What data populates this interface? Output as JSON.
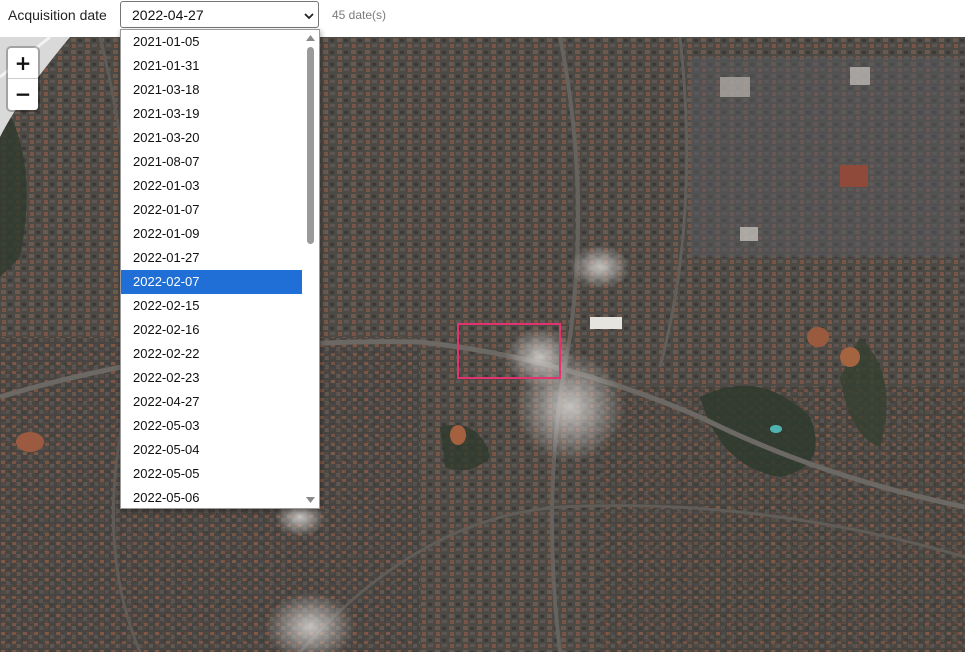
{
  "toolbar": {
    "label": "Acquisition date",
    "selected_value": "2022-04-27",
    "count_text": "45 date(s)"
  },
  "map": {
    "zoom_in_label": "+",
    "zoom_out_label": "−",
    "aoi_color": "#e0336f"
  },
  "dropdown": {
    "highlighted": "2022-02-07",
    "options": [
      "2021-01-05",
      "2021-01-31",
      "2021-03-18",
      "2021-03-19",
      "2021-03-20",
      "2021-08-07",
      "2022-01-03",
      "2022-01-07",
      "2022-01-09",
      "2022-01-27",
      "2022-02-07",
      "2022-02-15",
      "2022-02-16",
      "2022-02-22",
      "2022-02-23",
      "2022-04-27",
      "2022-05-03",
      "2022-05-04",
      "2022-05-05",
      "2022-05-06"
    ],
    "highlight_color": "#1f6fd6"
  }
}
